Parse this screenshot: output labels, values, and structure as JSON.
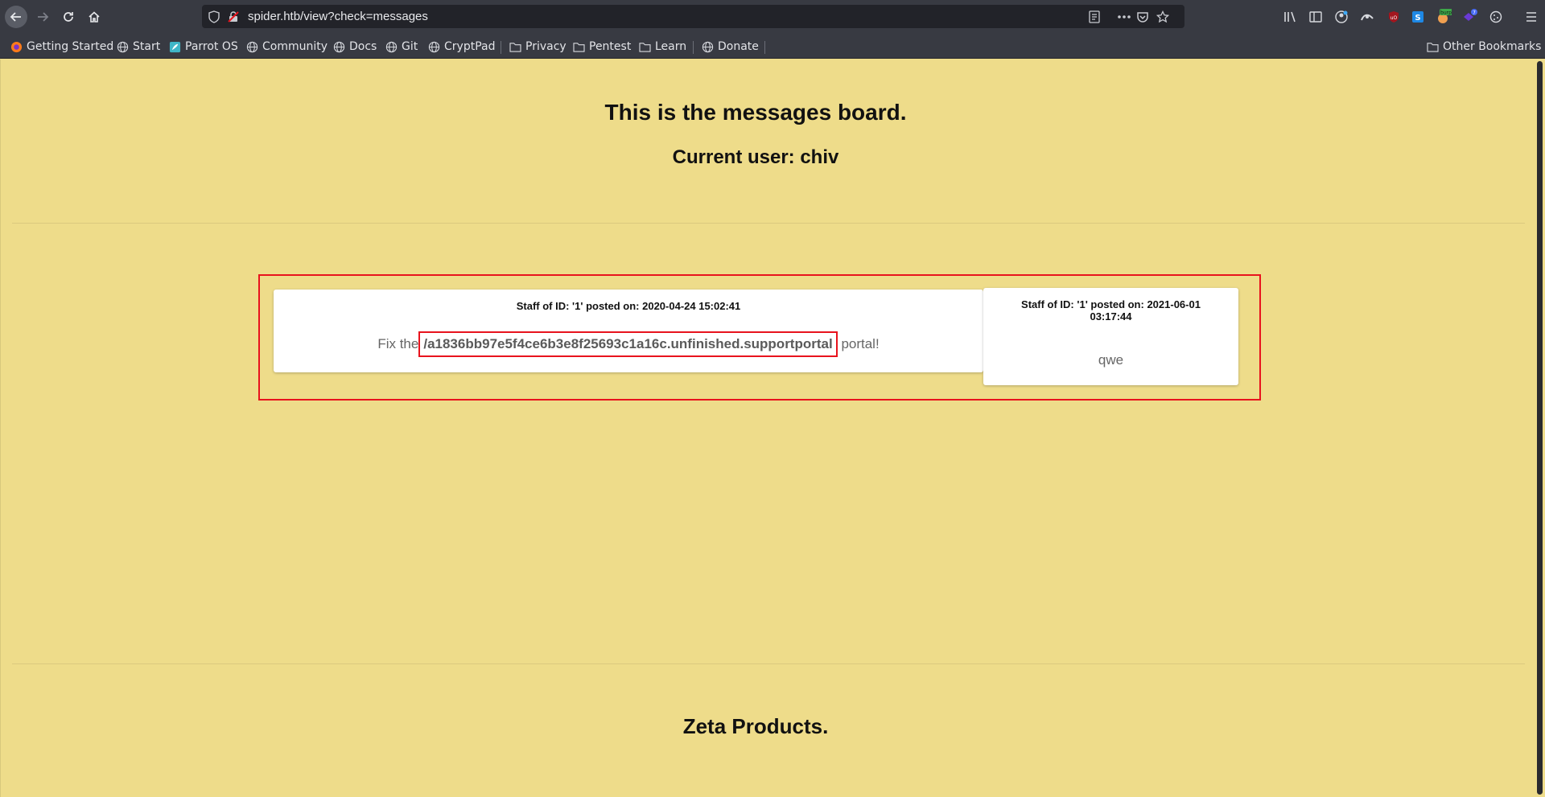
{
  "browser": {
    "url": "spider.htb/view?check=messages",
    "bookmarks": [
      {
        "label": "Getting Started",
        "icon": "firefox-icon"
      },
      {
        "label": "Start",
        "icon": "globe-icon"
      },
      {
        "label": "Parrot OS",
        "icon": "parrot-icon"
      },
      {
        "label": "Community",
        "icon": "globe-icon"
      },
      {
        "label": "Docs",
        "icon": "globe-icon"
      },
      {
        "label": "Git",
        "icon": "globe-icon"
      },
      {
        "label": "CryptPad",
        "icon": "globe-icon"
      },
      {
        "label": "Privacy",
        "icon": "folder-icon"
      },
      {
        "label": "Pentest",
        "icon": "folder-icon"
      },
      {
        "label": "Learn",
        "icon": "folder-icon"
      },
      {
        "label": "Donate",
        "icon": "globe-icon"
      }
    ],
    "other_bookmarks": "Other Bookmarks",
    "extension_badges": {
      "burp": "burp",
      "count": "7"
    }
  },
  "page": {
    "title": "This is the messages board.",
    "current_user": "Current user: chiv",
    "messages": [
      {
        "meta": "Staff of ID: '1' posted on: 2020-04-24 15:02:41",
        "body_prefix": "Fix the",
        "body_highlight": "/a1836bb97e5f4ce6b3e8f25693c1a16c.unfinished.supportportal",
        "body_suffix": "portal!"
      },
      {
        "meta_line1": "Staff of ID: '1' posted on: 2021-06-01",
        "meta_line2": "03:17:44",
        "body": "qwe"
      }
    ],
    "footer_title": "Zeta Products."
  },
  "colors": {
    "page_bg": "#eedc8a",
    "highlight": "#e8131d",
    "chrome_bg": "#383a42"
  }
}
